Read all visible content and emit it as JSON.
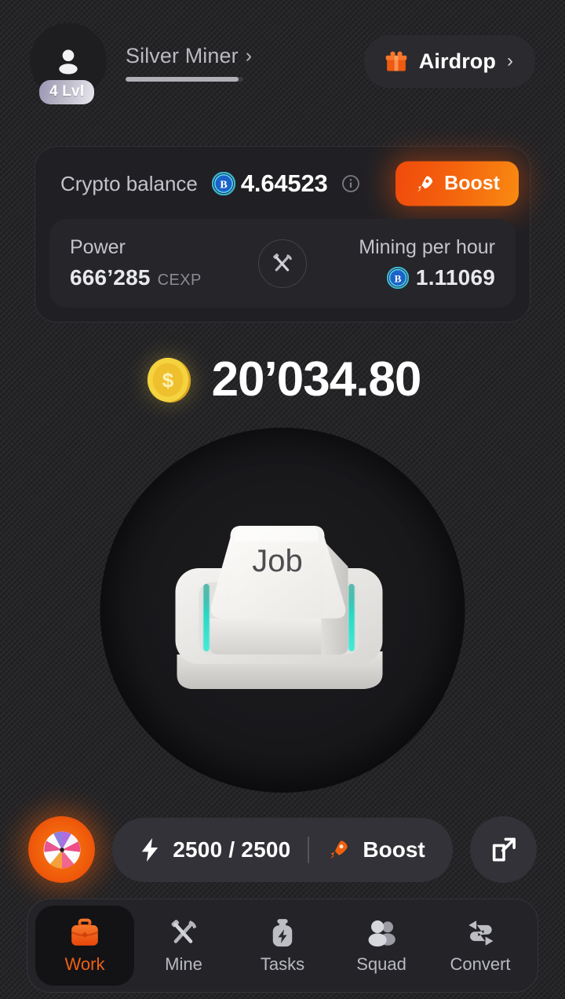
{
  "header": {
    "avatar_icon": "person-icon",
    "level_badge": "4 Lvl",
    "rank_name": "Silver Miner",
    "rank_chevron": "›",
    "rank_progress_percent": 96,
    "airdrop": {
      "icon": "gift-icon",
      "label": "Airdrop",
      "chevron": "›"
    }
  },
  "balance_card": {
    "label": "Crypto balance",
    "currency_icon": "bitcoin-icon",
    "value": "4.64523",
    "info_icon": "info-icon",
    "boost": {
      "icon": "rocket-icon",
      "label": "Boost",
      "color": "#f4550a"
    },
    "stats": {
      "pick_icon": "pickaxe-icon",
      "power": {
        "title": "Power",
        "value": "666’285",
        "unit": "CEXP"
      },
      "mining": {
        "title": "Mining per hour",
        "currency_icon": "bitcoin-icon",
        "value": "1.11069"
      }
    }
  },
  "coin_counter": {
    "icon": "gold-coin-icon",
    "amount": "20’034.80"
  },
  "tap_button": {
    "name": "job-key-button",
    "label": "Job"
  },
  "energy_row": {
    "wheel_icon": "fortune-wheel-icon",
    "bolt_icon": "lightning-bolt-icon",
    "energy_text": "2500 / 2500",
    "energy_current": 2500,
    "energy_max": 2500,
    "boost_icon": "rocket-icon",
    "boost_label": "Boost",
    "share_icon": "external-link-icon"
  },
  "bottom_nav": {
    "active_index": 0,
    "accent_color": "#ef5f14",
    "items": [
      {
        "label": "Work",
        "icon": "briefcase-icon"
      },
      {
        "label": "Mine",
        "icon": "pickaxe-icon"
      },
      {
        "label": "Tasks",
        "icon": "energy-jar-icon"
      },
      {
        "label": "Squad",
        "icon": "people-icon"
      },
      {
        "label": "Convert",
        "icon": "swap-arrows-icon"
      }
    ]
  }
}
